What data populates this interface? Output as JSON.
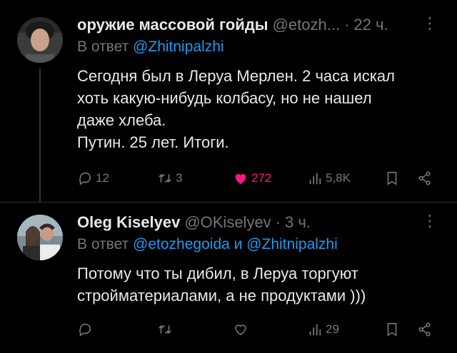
{
  "tweets": [
    {
      "author_name": "оружие массовой гойды",
      "handle": "@etozh...",
      "dot": "·",
      "time": "22 ч.",
      "more": "⋮",
      "reply_prefix": "В ответ",
      "reply_mention_1": "@Zhitnipalzhi",
      "body_lines": [
        "Сегодня был в Леруа Мерлен. 2 часа искал",
        "хоть какую-нибудь колбасу, но не нашел",
        "даже хлеба.",
        "Путин. 25 лет. Итоги."
      ],
      "stats": {
        "replies": "12",
        "reposts": "3",
        "likes": "272",
        "views": "5,8K"
      }
    },
    {
      "author_name": "Oleg Kiselyev",
      "handle": "@OKiselyev",
      "dot": "·",
      "time": "3 ч.",
      "more": "⋮",
      "reply_prefix": "В ответ",
      "reply_mention_1": "@etozhegoida",
      "reply_and": "и",
      "reply_mention_2": "@Zhitnipalzhi",
      "body_lines": [
        "Потому что ты дибил, в Леруа торгуют",
        "стройматериалами, а не продуктами )))"
      ],
      "stats": {
        "views": "29"
      }
    }
  ],
  "colors": {
    "accent": "#1d9bf0",
    "like": "#f91880",
    "muted": "#71767b",
    "text": "#e7e9ea",
    "bg": "#000000"
  },
  "icons": [
    "reply-icon",
    "repost-icon",
    "like-icon",
    "views-icon",
    "bookmark-icon",
    "share-icon",
    "more-icon"
  ]
}
